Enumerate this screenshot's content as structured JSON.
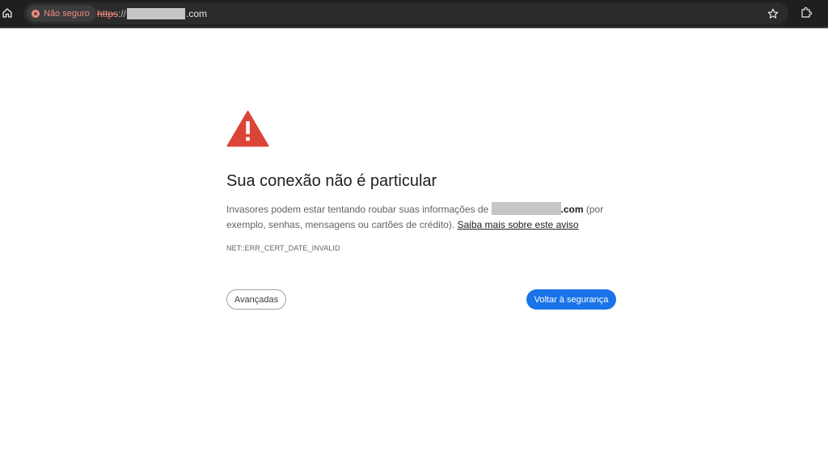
{
  "browser": {
    "security_chip_label": "Não seguro",
    "url": {
      "scheme": "https",
      "separator": "://",
      "host_tail": ".com"
    },
    "colors": {
      "toolbar_bg": "#1f1f1f",
      "omnibox_bg": "#2b2b2b",
      "insecure_red": "#f28b82"
    },
    "icons": [
      "home-icon",
      "not-secure-icon",
      "bookmark-star-icon",
      "extensions-icon"
    ]
  },
  "interstitial": {
    "icon": "warning-triangle-icon",
    "heading": "Sua conexão não é particular",
    "body": {
      "before_host": "Invasores podem estar tentando roubar suas informações de ",
      "host_tail": ".com",
      "after_host": " (por exemplo, senhas, mensagens ou cartões de crédito). ",
      "learn_more": "Saiba mais sobre este aviso"
    },
    "error_code": "NET::ERR_CERT_DATE_INVALID",
    "buttons": {
      "advanced": "Avançadas",
      "back_to_safety": "Voltar à segurança"
    },
    "colors": {
      "warning_red": "#db4437",
      "primary_blue": "#1a73e8",
      "heading_text": "#202124",
      "body_text": "#5f6368"
    }
  }
}
